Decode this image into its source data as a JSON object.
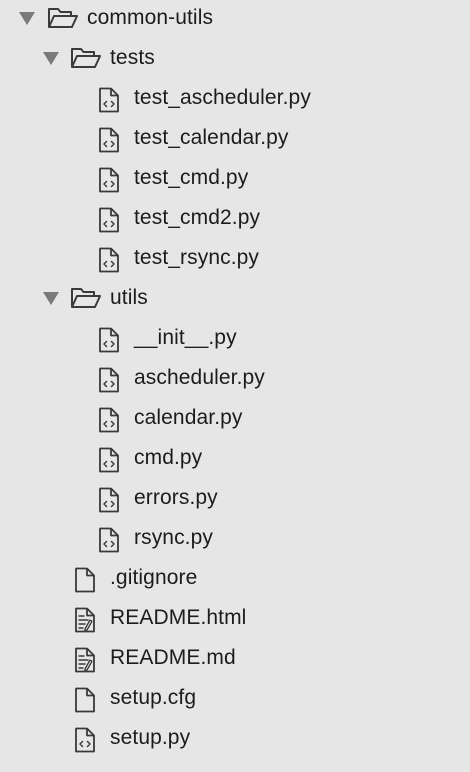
{
  "tree": {
    "root": {
      "label": "common-utils",
      "icon": "folder-open-icon",
      "expanded": true
    },
    "tests": {
      "label": "tests",
      "icon": "folder-open-icon",
      "expanded": true,
      "files": [
        {
          "label": "test_ascheduler.py",
          "icon": "code-file-icon"
        },
        {
          "label": "test_calendar.py",
          "icon": "code-file-icon"
        },
        {
          "label": "test_cmd.py",
          "icon": "code-file-icon"
        },
        {
          "label": "test_cmd2.py",
          "icon": "code-file-icon"
        },
        {
          "label": "test_rsync.py",
          "icon": "code-file-icon"
        }
      ]
    },
    "utils": {
      "label": "utils",
      "icon": "folder-open-icon",
      "expanded": true,
      "files": [
        {
          "label": "__init__.py",
          "icon": "code-file-icon"
        },
        {
          "label": "ascheduler.py",
          "icon": "code-file-icon"
        },
        {
          "label": "calendar.py",
          "icon": "code-file-icon"
        },
        {
          "label": "cmd.py",
          "icon": "code-file-icon"
        },
        {
          "label": "errors.py",
          "icon": "code-file-icon"
        },
        {
          "label": "rsync.py",
          "icon": "code-file-icon"
        }
      ]
    },
    "root_files": [
      {
        "label": ".gitignore",
        "icon": "blank-file-icon"
      },
      {
        "label": "README.html",
        "icon": "markup-file-icon"
      },
      {
        "label": "README.md",
        "icon": "markup-file-icon"
      },
      {
        "label": "setup.cfg",
        "icon": "blank-file-icon"
      },
      {
        "label": "setup.py",
        "icon": "code-file-icon"
      }
    ]
  },
  "colors": {
    "background": "#e6e6e6",
    "icon_stroke": "#3a3a3a",
    "arrow": "#7a7a7a",
    "text": "#1c1c1c"
  }
}
